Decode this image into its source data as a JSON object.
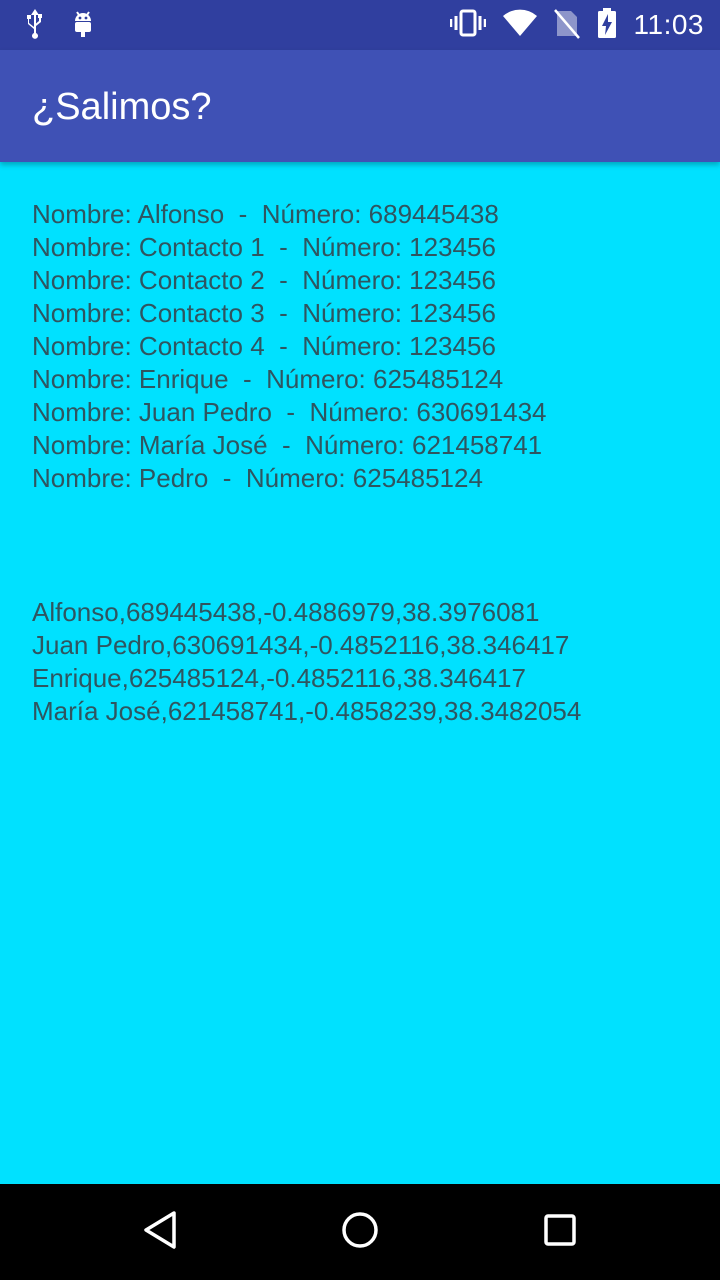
{
  "status_bar": {
    "time": "11:03",
    "icons": [
      "usb-icon",
      "android-debug-icon",
      "vibrate-icon",
      "wifi-icon",
      "no-sim-icon",
      "battery-charging-icon"
    ]
  },
  "app_bar": {
    "title": "¿Salimos?"
  },
  "contacts": [
    "Nombre: Alfonso  -  Número: 689445438",
    "Nombre: Contacto 1  -  Número: 123456",
    "Nombre: Contacto 2  -  Número: 123456",
    "Nombre: Contacto 3  -  Número: 123456",
    "Nombre: Contacto 4  -  Número: 123456",
    "Nombre: Enrique  -  Número: 625485124",
    "Nombre: Juan Pedro  -  Número: 630691434",
    "Nombre: María José  -  Número: 621458741",
    "Nombre: Pedro  -  Número: 625485124"
  ],
  "locations": [
    "Alfonso,689445438,-0.4886979,38.3976081",
    "Juan Pedro,630691434,-0.4852116,38.346417",
    "Enrique,625485124,-0.4852116,38.346417",
    "María José,621458741,-0.4858239,38.3482054"
  ],
  "nav_bar": {
    "icons": [
      "back-icon",
      "home-icon",
      "recents-icon"
    ]
  },
  "colors": {
    "status_bar": "#303f9f",
    "app_bar": "#3f51b5",
    "background": "#00e1ff",
    "text": "#2f5560"
  }
}
